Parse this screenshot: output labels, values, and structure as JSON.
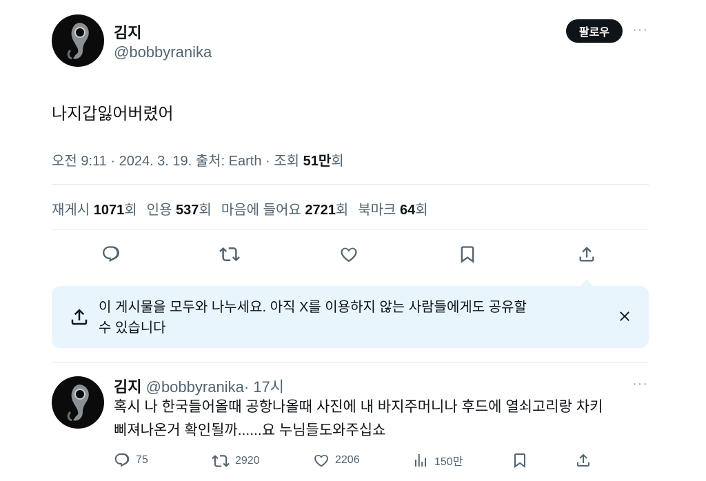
{
  "tweet": {
    "author_name": "김지",
    "author_handle": "@bobbyranika",
    "follow_label": "팔로우",
    "more_label": "···",
    "text": "나지갑잃어버렸어",
    "meta_prefix": "오전 9:11 · 2024. 3. 19. 출처: Earth · 조회 ",
    "views_value": "51만",
    "views_suffix": "회",
    "stats": [
      {
        "label": "재게시 ",
        "value": "1071",
        "suffix": "회"
      },
      {
        "label": "인용 ",
        "value": "537",
        "suffix": "회"
      },
      {
        "label": "마음에 들어요 ",
        "value": "2721",
        "suffix": "회"
      },
      {
        "label": "북마크 ",
        "value": "64",
        "suffix": "회"
      }
    ],
    "actions": [
      "reply-icon",
      "retweet-icon",
      "like-icon",
      "bookmark-icon",
      "share-icon"
    ]
  },
  "share_prompt": {
    "line1": "이 게시물을 모두와 나누세요. 아직 X를 이용하지 않는 사람들에게도 공유할",
    "line2": "수 있습니다",
    "close_icon": "close-icon"
  },
  "reply": {
    "author_name": "김지",
    "author_handle": "@bobbyranika",
    "time": "· 17시",
    "more_label": "···",
    "line1": "혹시 나 한국들어올때 공항나올때 사진에 내 바지주머니나 후드에 열쇠고리랑 차키",
    "line2": "삐져나온거 확인될까......요 누님들도와주십쇼",
    "counts": {
      "replies": "75",
      "retweets": "2920",
      "likes": "2206",
      "views": "150만"
    }
  },
  "colors": {
    "text": "#0f1419",
    "secondary": "#536471",
    "share_bg": "#e8f5fd",
    "button_bg": "#0f1419"
  }
}
